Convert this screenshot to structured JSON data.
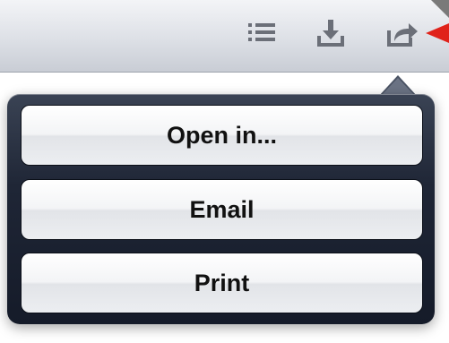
{
  "toolbar": {
    "buttons": [
      {
        "icon": "list-icon"
      },
      {
        "icon": "download-icon"
      },
      {
        "icon": "share-icon"
      }
    ],
    "icon_color": "#6b6f78"
  },
  "popover": {
    "items": [
      {
        "label": "Open in..."
      },
      {
        "label": "Email"
      },
      {
        "label": "Print"
      }
    ]
  },
  "annotation": {
    "color": "#e0221a"
  }
}
